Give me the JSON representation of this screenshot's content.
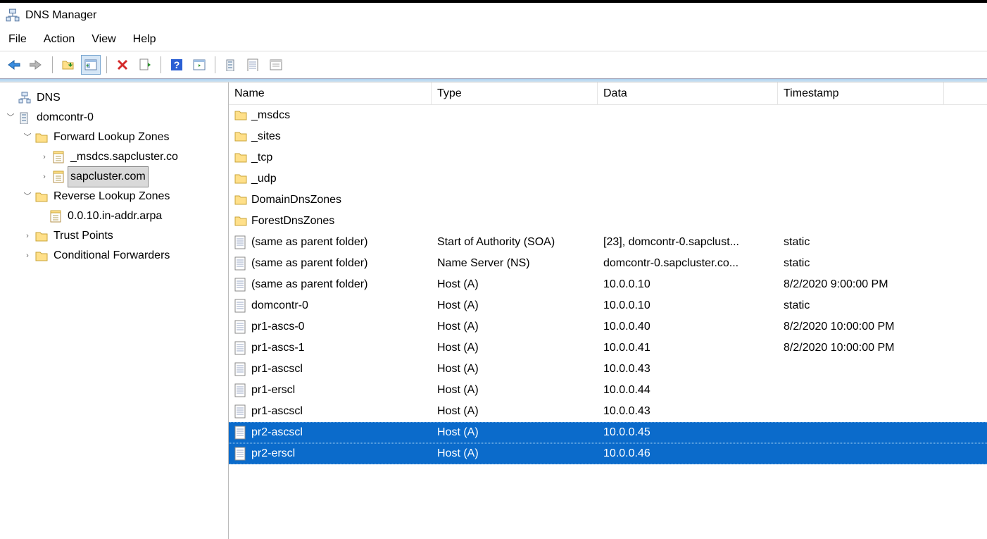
{
  "app": {
    "title": "DNS Manager"
  },
  "menu": {
    "file": "File",
    "action": "Action",
    "view": "View",
    "help": "Help"
  },
  "tree": {
    "root": "DNS",
    "server": "domcontr-0",
    "flz": "Forward Lookup Zones",
    "flz_children": [
      "_msdcs.sapcluster.co",
      "sapcluster.com"
    ],
    "rlz": "Reverse Lookup Zones",
    "rlz_children": [
      "0.0.10.in-addr.arpa"
    ],
    "tp": "Trust Points",
    "cf": "Conditional Forwarders"
  },
  "columns": {
    "name": "Name",
    "type": "Type",
    "data": "Data",
    "ts": "Timestamp"
  },
  "folder_rows": [
    "_msdcs",
    "_sites",
    "_tcp",
    "_udp",
    "DomainDnsZones",
    "ForestDnsZones"
  ],
  "records": [
    {
      "name": "(same as parent folder)",
      "type": "Start of Authority (SOA)",
      "data": "[23], domcontr-0.sapclust...",
      "ts": "static"
    },
    {
      "name": "(same as parent folder)",
      "type": "Name Server (NS)",
      "data": "domcontr-0.sapcluster.co...",
      "ts": "static"
    },
    {
      "name": "(same as parent folder)",
      "type": "Host (A)",
      "data": "10.0.0.10",
      "ts": "8/2/2020 9:00:00 PM"
    },
    {
      "name": "domcontr-0",
      "type": "Host (A)",
      "data": "10.0.0.10",
      "ts": "static"
    },
    {
      "name": "pr1-ascs-0",
      "type": "Host (A)",
      "data": "10.0.0.40",
      "ts": "8/2/2020 10:00:00 PM"
    },
    {
      "name": "pr1-ascs-1",
      "type": "Host (A)",
      "data": "10.0.0.41",
      "ts": "8/2/2020 10:00:00 PM"
    },
    {
      "name": "pr1-ascscl",
      "type": "Host (A)",
      "data": "10.0.0.43",
      "ts": ""
    },
    {
      "name": "pr1-erscl",
      "type": "Host (A)",
      "data": "10.0.0.44",
      "ts": ""
    },
    {
      "name": "pr1-ascscl",
      "type": "Host (A)",
      "data": "10.0.0.43",
      "ts": ""
    },
    {
      "name": "pr2-ascscl",
      "type": "Host (A)",
      "data": "10.0.0.45",
      "ts": "",
      "selected": true
    },
    {
      "name": "pr2-erscl",
      "type": "Host (A)",
      "data": "10.0.0.46",
      "ts": "",
      "selected": true
    }
  ]
}
